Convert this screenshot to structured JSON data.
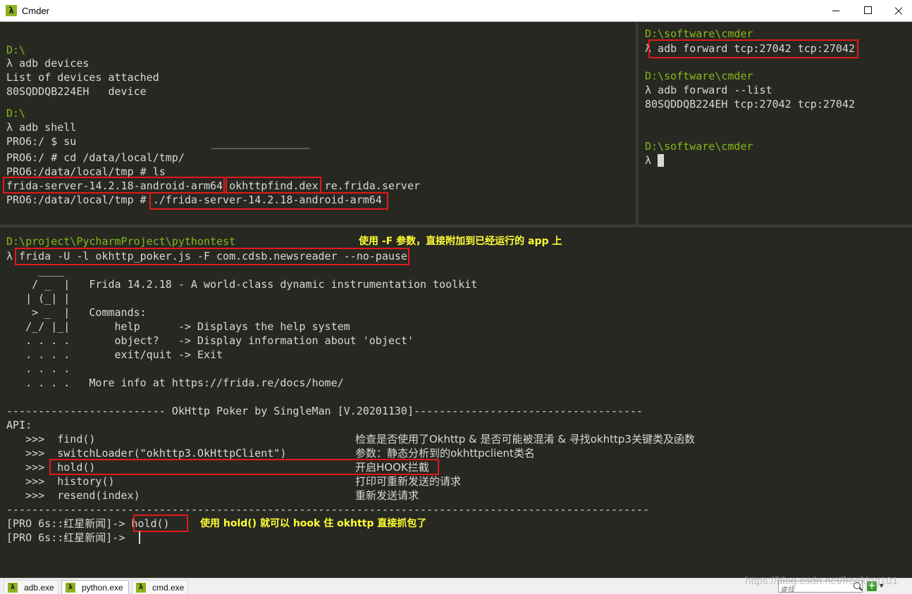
{
  "window": {
    "title": "Cmder",
    "icon": "lambda-icon"
  },
  "pane_top_left": {
    "lines": [
      {
        "text": "D:\\",
        "kind": "path"
      },
      {
        "text": "λ adb devices",
        "kind": "cmd"
      },
      {
        "text": "List of devices attached",
        "kind": "out"
      },
      {
        "text": "80SQDDQB224EH   device",
        "kind": "out"
      },
      {
        "text": "D:\\",
        "kind": "path"
      },
      {
        "text": "λ adb shell",
        "kind": "cmd"
      },
      {
        "text": "PRO6:/ $ su",
        "kind": "out"
      },
      {
        "text": "PRO6:/ # cd /data/local/tmp/",
        "kind": "out"
      },
      {
        "text": "PRO6:/data/local/tmp # ls",
        "kind": "out"
      },
      {
        "text": "frida-server-14.2.18-android-arm64 okhttpfind.dex re.frida.server",
        "kind": "out"
      },
      {
        "text": "PRO6:/data/local/tmp # ./frida-server-14.2.18-android-arm64",
        "kind": "out"
      }
    ]
  },
  "pane_top_right": {
    "lines": [
      {
        "text": "D:\\software\\cmder",
        "kind": "path"
      },
      {
        "text": "λ adb forward tcp:27042 tcp:27042",
        "kind": "cmd"
      },
      {
        "text": "D:\\software\\cmder",
        "kind": "path"
      },
      {
        "text": "λ adb forward --list",
        "kind": "cmd"
      },
      {
        "text": "80SQDDQB224EH tcp:27042 tcp:27042",
        "kind": "out"
      },
      {
        "text": "D:\\software\\cmder",
        "kind": "path"
      },
      {
        "text": "λ ",
        "kind": "cmd"
      }
    ]
  },
  "pane_bottom": {
    "path": "D:\\project\\PycharmProject\\pythontest",
    "command": "λ frida -U -l okhttp_poker.js -F com.cdsb.newsreader --no-pause",
    "banner": [
      "     ____",
      "    / _  |   Frida 14.2.18 - A world-class dynamic instrumentation toolkit",
      "   | (_| |",
      "    > _  |   Commands:",
      "   /_/ |_|       help      -> Displays the help system",
      "   . . . .       object?   -> Display information about 'object'",
      "   . . . .       exit/quit -> Exit",
      "   . . . .",
      "   . . . .   More info at https://frida.re/docs/home/"
    ],
    "separator": "------------------------- OkHttp Poker by SingleMan [V.20201130]------------------------------------",
    "api_label": "API:",
    "api": [
      {
        "cmd": "   >>>  find()",
        "desc": "检查是否使用了Okhttp & 是否可能被混淆 & 寻找okhttp3关键类及函数"
      },
      {
        "cmd": "   >>>  switchLoader(\"okhttp3.OkHttpClient\")",
        "desc": "参数：静态分析到的okhttpclient类名"
      },
      {
        "cmd": "   >>>  hold()",
        "desc": "开启HOOK拦截"
      },
      {
        "cmd": "   >>>  history()",
        "desc": "打印可重新发送的请求"
      },
      {
        "cmd": "   >>>  resend(index)",
        "desc": "重新发送请求"
      }
    ],
    "separator2": "-----------------------------------------------------------------------------------------------------",
    "prompt1": "[PRO 6s::红星新闻]-> hold()",
    "prompt2": "[PRO 6s::红星新闻]-> ",
    "annotation_top": "使用 -F 参数，直接附加到已经运行的 app 上",
    "annotation_hold": "使用 hold() 就可以 hook 住 okhttp 直接抓包了"
  },
  "taskbar": {
    "tabs": [
      {
        "label": "adb.exe",
        "active": false
      },
      {
        "label": "python.exe",
        "active": true
      },
      {
        "label": "cmd.exe",
        "active": false
      }
    ],
    "search_placeholder": "查找",
    "watermark": "https://blog.csdn.net/freeking101"
  },
  "colors": {
    "background": "#272822",
    "text": "#d8d8d8",
    "path": "#84b81a",
    "annotation": "#ffff33",
    "highlight_box": "#e01a1a"
  }
}
